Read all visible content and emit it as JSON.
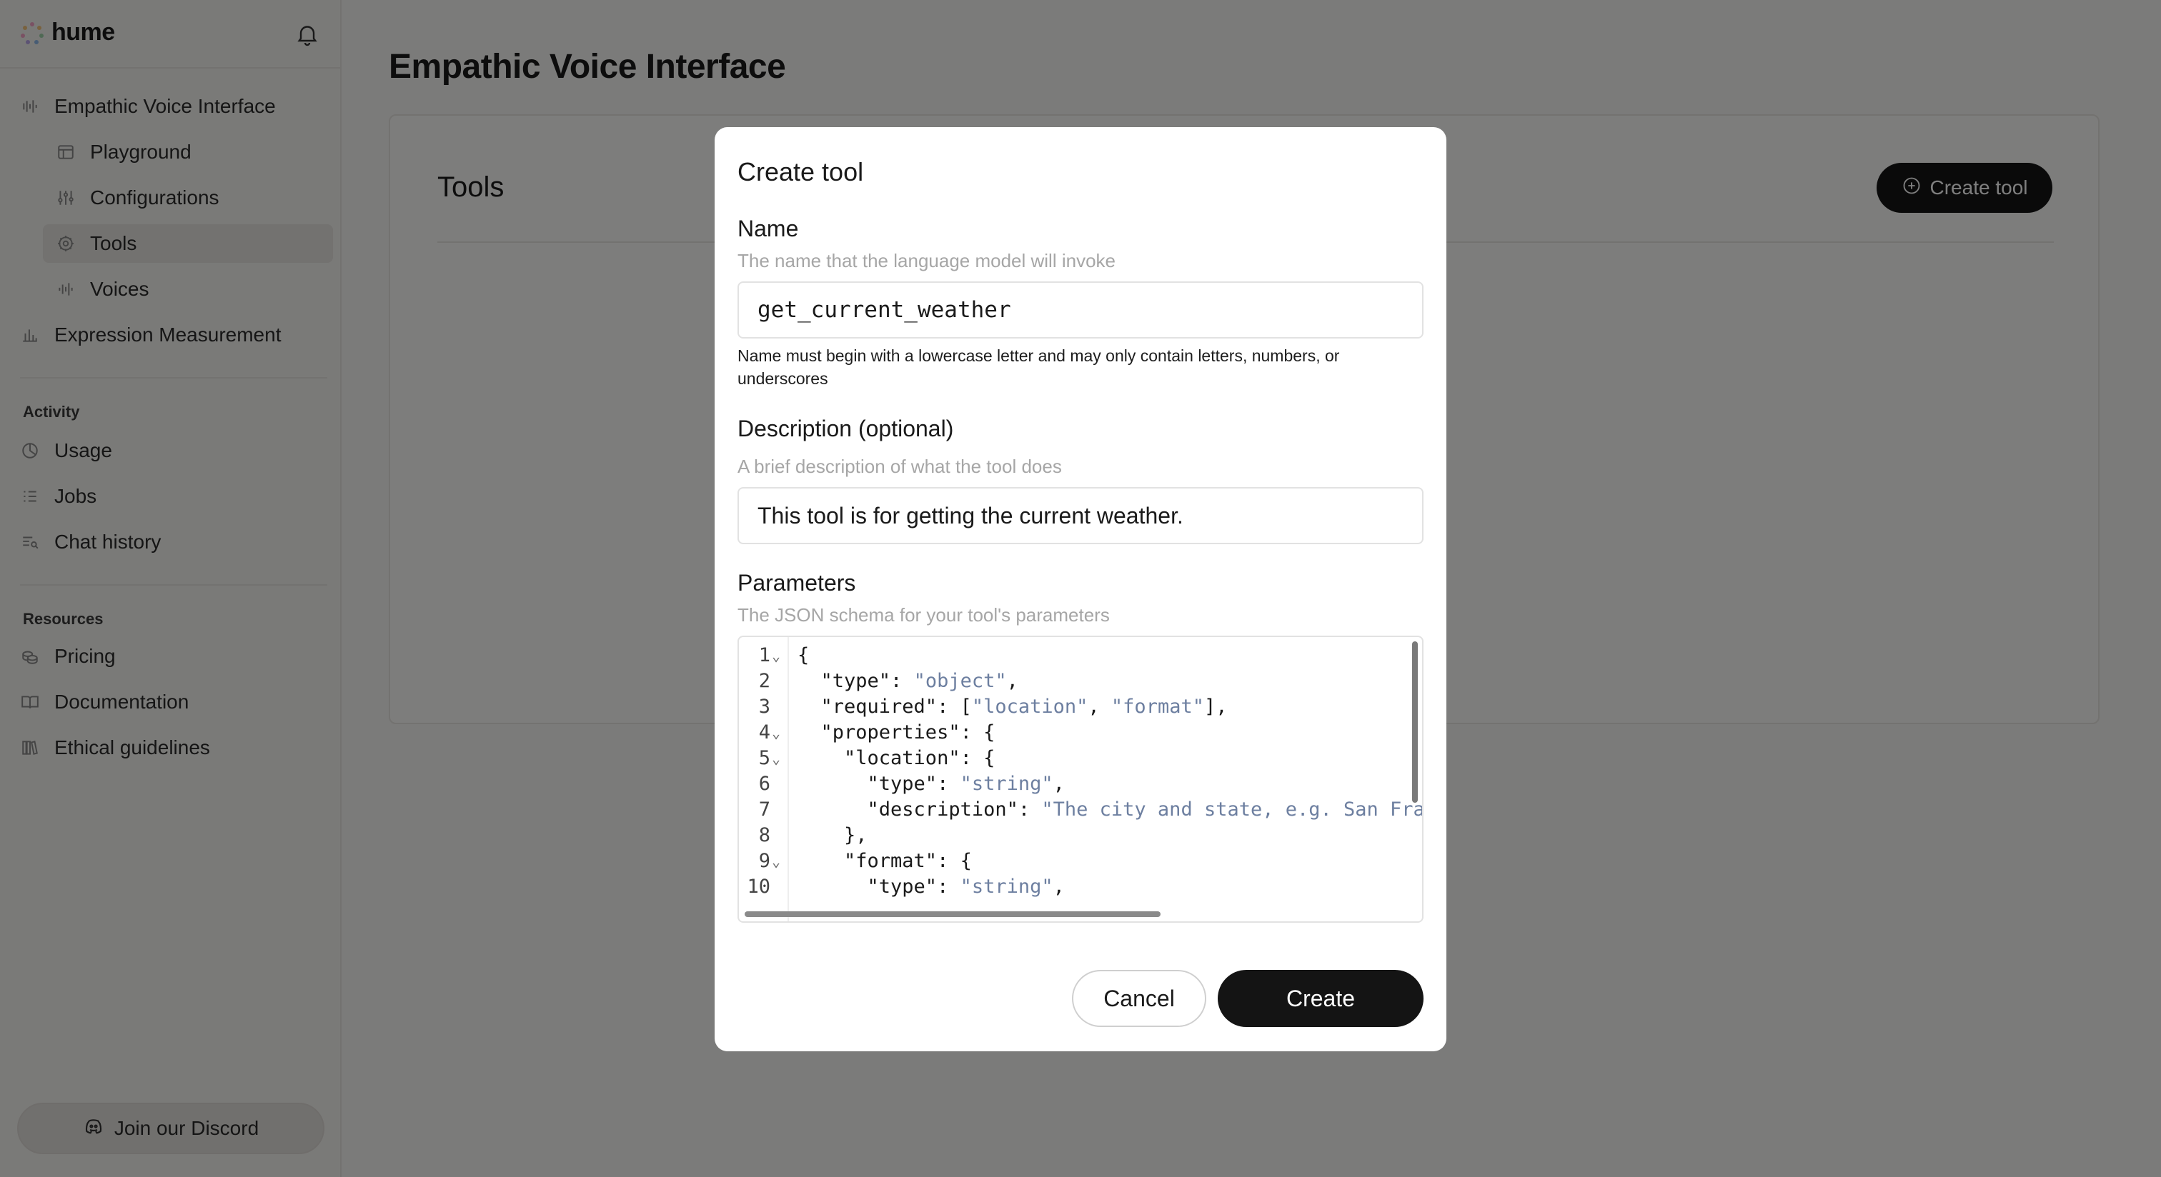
{
  "app": {
    "logo_text": "hume",
    "accent_colors": [
      "#f5a3c7",
      "#f2c57c",
      "#9fd3a8",
      "#8fb8e8"
    ]
  },
  "sidebar": {
    "items": [
      {
        "label": "Empathic Voice Interface",
        "icon": "waveform-icon"
      },
      {
        "label": "Playground",
        "icon": "layout-icon"
      },
      {
        "label": "Configurations",
        "icon": "sliders-icon"
      },
      {
        "label": "Tools",
        "icon": "gear-icon",
        "active": true
      },
      {
        "label": "Voices",
        "icon": "waveform-icon"
      },
      {
        "label": "Expression Measurement",
        "icon": "bar-chart-icon"
      }
    ],
    "activity_heading": "Activity",
    "activity_items": [
      {
        "label": "Usage",
        "icon": "pie-chart-icon"
      },
      {
        "label": "Jobs",
        "icon": "checklist-icon"
      },
      {
        "label": "Chat history",
        "icon": "chat-list-icon"
      }
    ],
    "resources_heading": "Resources",
    "resources_items": [
      {
        "label": "Pricing",
        "icon": "coins-icon"
      },
      {
        "label": "Documentation",
        "icon": "book-icon"
      },
      {
        "label": "Ethical guidelines",
        "icon": "books-icon"
      }
    ],
    "discord_label": "Join our Discord"
  },
  "main": {
    "title": "Empathic Voice Interface",
    "tools_title": "Tools",
    "create_tool_label": "Create tool"
  },
  "modal": {
    "title": "Create tool",
    "name_label": "Name",
    "name_help": "The name that the language model will invoke",
    "name_value": "get_current_weather",
    "name_note": "Name must begin with a lowercase letter and may only contain letters, numbers, or underscores",
    "description_label": "Description (optional)",
    "description_help": "A brief description of what the tool does",
    "description_value": "This tool is for getting the current weather.",
    "parameters_label": "Parameters",
    "parameters_help": "The JSON schema for your tool's parameters",
    "code_lines": [
      {
        "n": "1",
        "fold": true,
        "text": "{"
      },
      {
        "n": "2",
        "fold": false,
        "text": "  \"type\": \"object\","
      },
      {
        "n": "3",
        "fold": false,
        "text": "  \"required\": [\"location\", \"format\"],"
      },
      {
        "n": "4",
        "fold": true,
        "text": "  \"properties\": {"
      },
      {
        "n": "5",
        "fold": true,
        "text": "    \"location\": {"
      },
      {
        "n": "6",
        "fold": false,
        "text": "      \"type\": \"string\","
      },
      {
        "n": "7",
        "fold": false,
        "text": "      \"description\": \"The city and state, e.g. San Fran"
      },
      {
        "n": "8",
        "fold": false,
        "text": "    },"
      },
      {
        "n": "9",
        "fold": true,
        "text": "    \"format\": {"
      },
      {
        "n": "10",
        "fold": false,
        "text": "      \"type\": \"string\","
      }
    ],
    "cancel_label": "Cancel",
    "create_label": "Create"
  }
}
